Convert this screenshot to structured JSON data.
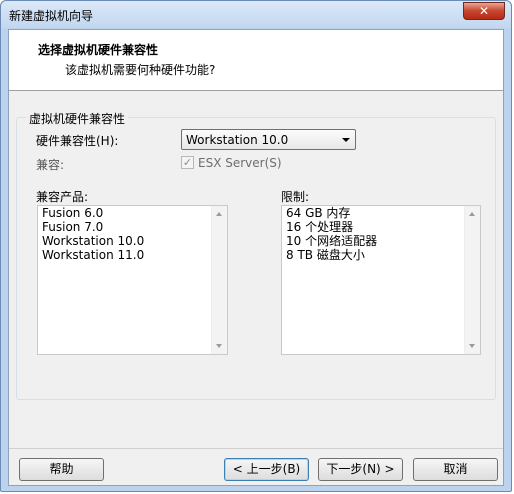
{
  "window": {
    "title": "新建虚拟机向导",
    "close_label": "✕"
  },
  "header": {
    "title": "选择虚拟机硬件兼容性",
    "subtitle": "该虚拟机需要何种硬件功能?"
  },
  "group": {
    "label": "虚拟机硬件兼容性",
    "hardware_compat_label": "硬件兼容性(H):",
    "hardware_compat_value": "Workstation 10.0",
    "compat_label": "兼容:",
    "esx_checkbox_label": "ESX Server(S)",
    "compatible_products_label": "兼容产品:",
    "limits_label": "限制:"
  },
  "compatible_products": [
    "Fusion 6.0",
    "Fusion 7.0",
    "Workstation 10.0",
    "Workstation 11.0"
  ],
  "limits": [
    "64 GB 内存",
    "16 个处理器",
    "10 个网络适配器",
    "8 TB 磁盘大小"
  ],
  "buttons": {
    "help": "帮助",
    "back": "< 上一步(B)",
    "next": "下一步(N) >",
    "cancel": "取消"
  },
  "colors": {
    "close_button": "#c7452d",
    "window_frame": "#bcd3ee"
  }
}
